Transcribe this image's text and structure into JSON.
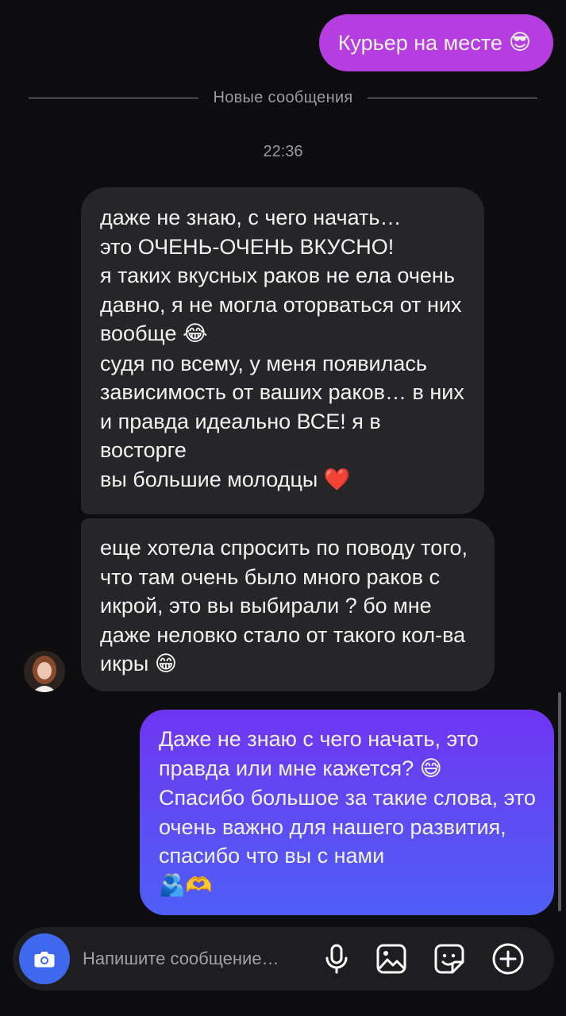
{
  "colors": {
    "background": "#0d0d0f",
    "incoming_bubble": "#262629",
    "outgoing_top_bubble": "#b63de0",
    "outgoing_bottom_gradient": [
      "#6f35f1",
      "#4f5ef6"
    ],
    "camera_button": "#3e68ee"
  },
  "messages": {
    "outgoing_top": {
      "text": "Курьер на месте",
      "emoji": "😎"
    },
    "new_messages_divider": "Новые сообщения",
    "timestamp": "22:36",
    "incoming_1": {
      "lines": [
        "даже не знаю, с чего начать…",
        "это ОЧЕНЬ-ОЧЕНЬ ВКУСНО!",
        "я таких вкусных раков не ела очень давно, я не могла оторваться от них вообще",
        "судя по всему, у меня появилась зависимость от ваших раков… в них и правда идеально ВСЕ! я в восторге",
        "вы большие молодцы"
      ],
      "emoji_laugh": "😂",
      "emoji_heart": "❤️"
    },
    "incoming_2": {
      "text": "еще хотела спросить по поводу того, что там очень было много раков с икрой, это вы выбирали ? бо мне даже неловко стало от такого кол-ва икры",
      "emoji": "😁"
    },
    "outgoing_2": {
      "line1": "Даже не знаю с чего начать, это правда или мне кажется?",
      "emoji1": "😅",
      "line2": "Спасибо большое за такие слова, это очень важно для нашего развития, спасибо что вы с нами",
      "emoji2": "🫂🫶"
    }
  },
  "composer": {
    "placeholder": "Напишите сообщение…",
    "icons": [
      "camera-icon",
      "microphone-icon",
      "image-icon",
      "sticker-icon",
      "add-icon"
    ]
  }
}
